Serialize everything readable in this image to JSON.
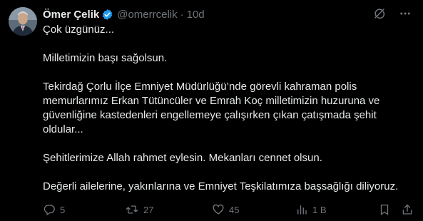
{
  "author": {
    "name": "Ömer Çelik",
    "handle": "@omerrcelik",
    "separator": "·",
    "time": "10d",
    "verified": true
  },
  "tweet": {
    "lines": [
      "Çok üzgünüz...",
      "Milletimizin başı sağolsun.",
      "Tekirdağ Çorlu İlçe Emniyet Müdürlüğü’nde görevli kahraman polis",
      "memurlarımız Erkan Tütüncüler ve Emrah Koç milletimizin huzuruna ve",
      "güvenliğine kastedenleri engellemeye çalışırken çıkan çatışmada şehit",
      "oldular...",
      "Şehitlerimize Allah rahmet eylesin. Mekanları cennet olsun.",
      "Değerli ailelerine, yakınlarına ve Emniyet Teşkilatımıza başsağlığı diliyoruz."
    ]
  },
  "actions": {
    "replies": "5",
    "reposts": "27",
    "likes": "45",
    "views": "1 B"
  },
  "icons": {
    "verified": "verified-badge-icon",
    "grok": "grok-icon",
    "more": "more-icon",
    "reply": "reply-icon",
    "repost": "repost-icon",
    "like": "like-icon",
    "views": "views-icon",
    "bookmark": "bookmark-icon",
    "share": "share-icon"
  },
  "colors": {
    "background": "#000000",
    "text": "#e7e9ea",
    "muted": "#71767b",
    "verified": "#1d9bf0"
  }
}
